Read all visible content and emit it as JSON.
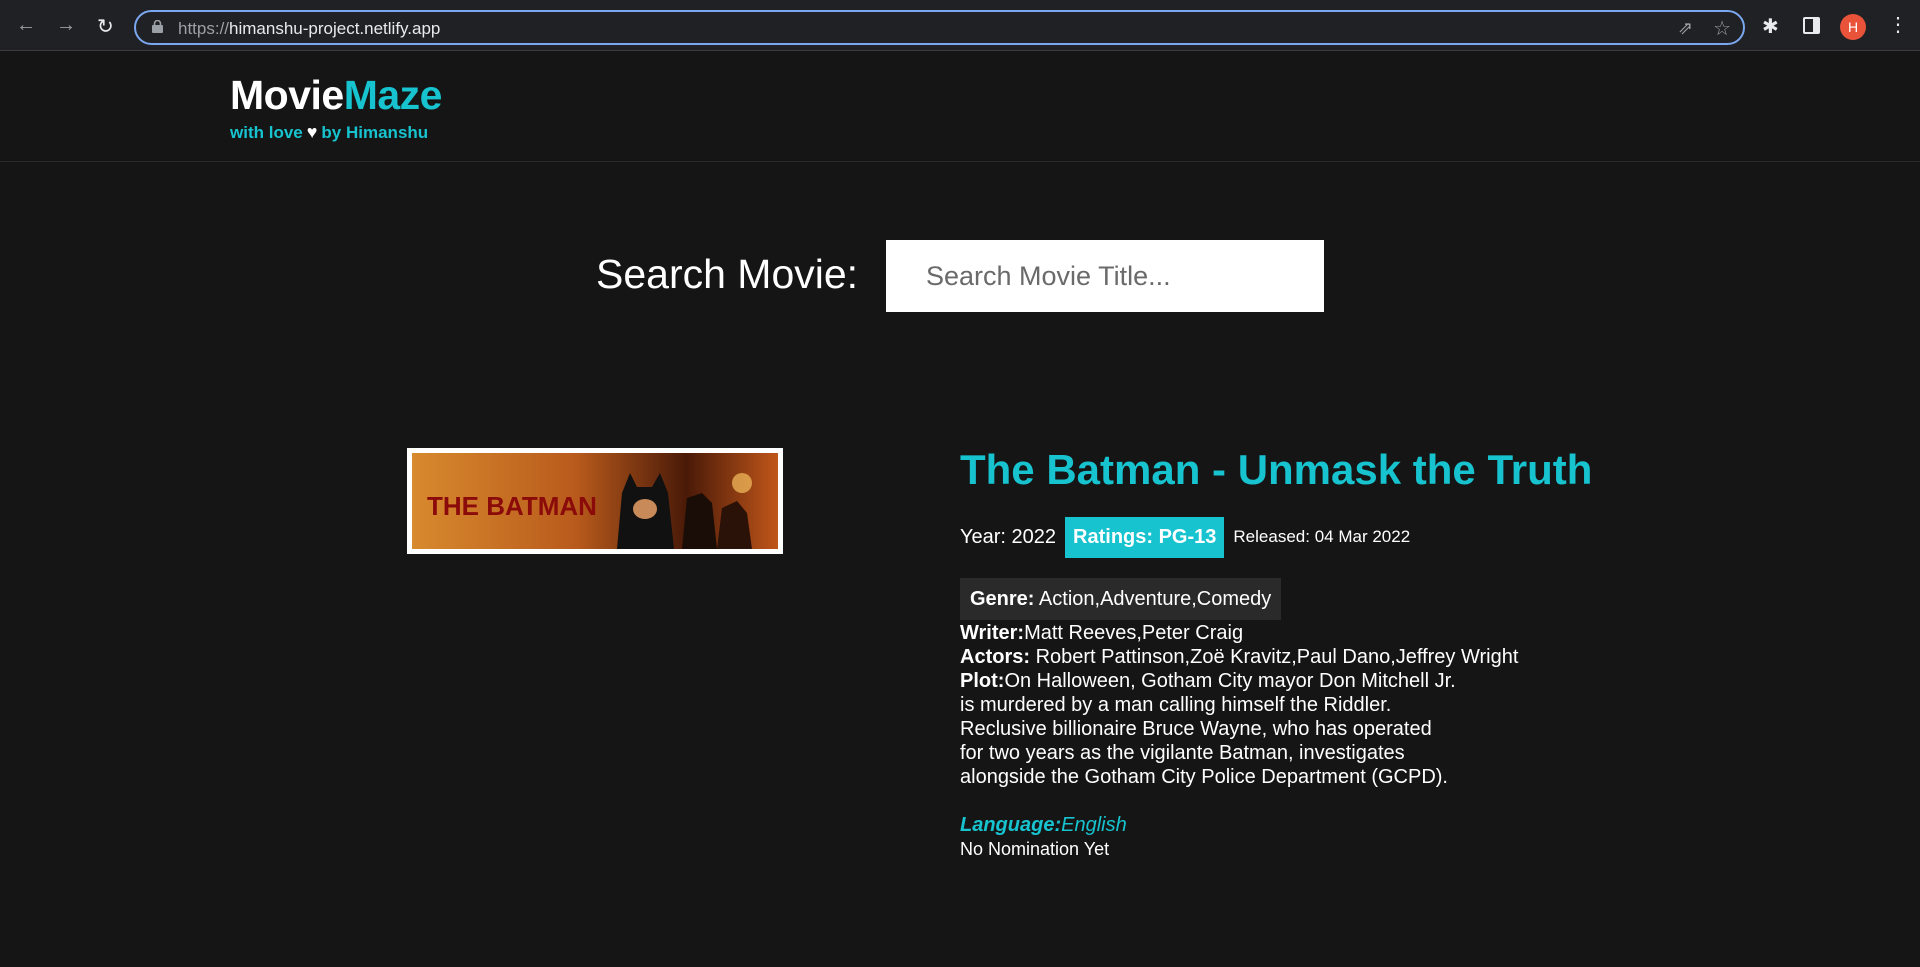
{
  "browser": {
    "url_scheme": "https://",
    "url_host": "himanshu-project.netlify.app",
    "profile_initial": "H",
    "accent_color": "#7aa7f0"
  },
  "site": {
    "brand_part1": "Movie",
    "brand_part2": "Maze",
    "tagline_before": "with love",
    "tagline_after": "by Himanshu",
    "accent_color": "#16c3cf"
  },
  "search": {
    "label": "Search Movie:",
    "placeholder": "Search Movie Title...",
    "value": ""
  },
  "movie": {
    "title": "The Batman - Unmask the Truth",
    "year_label": "Year:",
    "year": "2022",
    "ratings_label": "Ratings:",
    "rating": "PG-13",
    "released_label": "Released:",
    "released": "04 Mar 2022",
    "genre_label": "Genre:",
    "genre": "Action,Adventure,Comedy",
    "writer_label": "Writer:",
    "writer": "Matt Reeves,Peter Craig",
    "actors_label": "Actors:",
    "actors": "Robert Pattinson,Zoë Kravitz,Paul Dano,Jeffrey Wright",
    "plot_label": "Plot:",
    "plot": "On Halloween, Gotham City mayor Don Mitchell Jr. is murdered by a man calling himself the Riddler. Reclusive billionaire Bruce Wayne, who has operated for two years as the vigilante Batman, investigates alongside the Gotham City Police Department (GCPD).",
    "language_label": "Language:",
    "language": "English",
    "awards": "No Nomination Yet",
    "poster_text": "THE BATMAN"
  }
}
